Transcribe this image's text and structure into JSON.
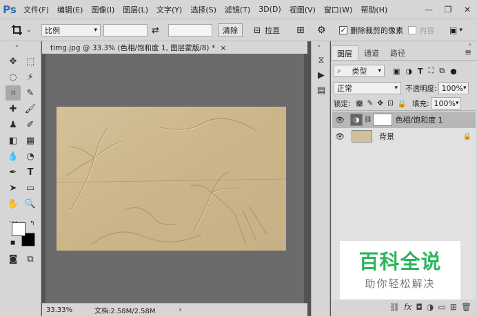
{
  "app": {
    "logo": "Ps"
  },
  "menu": [
    "文件(F)",
    "编辑(E)",
    "图像(I)",
    "图层(L)",
    "文字(Y)",
    "选择(S)",
    "滤镜(T)",
    "3D(D)",
    "视图(V)",
    "窗口(W)",
    "帮助(H)"
  ],
  "window_controls": {
    "minimize": "—",
    "restore": "❐",
    "close": "✕"
  },
  "options": {
    "tool_icon": "crop-icon",
    "ratio_label": "比例",
    "clear_label": "清除",
    "straighten_label": "拉直",
    "delete_cropped_label": "删除裁剪的像素",
    "delete_cropped_checked": true,
    "content_aware_label": "内容"
  },
  "document": {
    "tab_title": "timg.jpg @ 33.3% (色相/饱和度 1, 图层蒙版/8) *",
    "close": "×",
    "zoom": "33.33%",
    "doc_info": "文档:2.58M/2.58M"
  },
  "layers_panel": {
    "tabs": [
      "图层",
      "通道",
      "路径"
    ],
    "active_tab": 0,
    "filter_kind": "类型",
    "blend_mode": "正常",
    "opacity_label": "不透明度:",
    "opacity_value": "100%",
    "lock_label": "锁定:",
    "fill_label": "填充:",
    "fill_value": "100%",
    "layers": [
      {
        "name": "色相/饱和度 1",
        "selected": true
      },
      {
        "name": "背景",
        "selected": false
      }
    ]
  },
  "watermark": {
    "title": "百科全说",
    "subtitle": "助你轻松解决"
  },
  "colors": {
    "foreground": "#ffffff",
    "background": "#000000",
    "accent_green": "#2db55d"
  }
}
